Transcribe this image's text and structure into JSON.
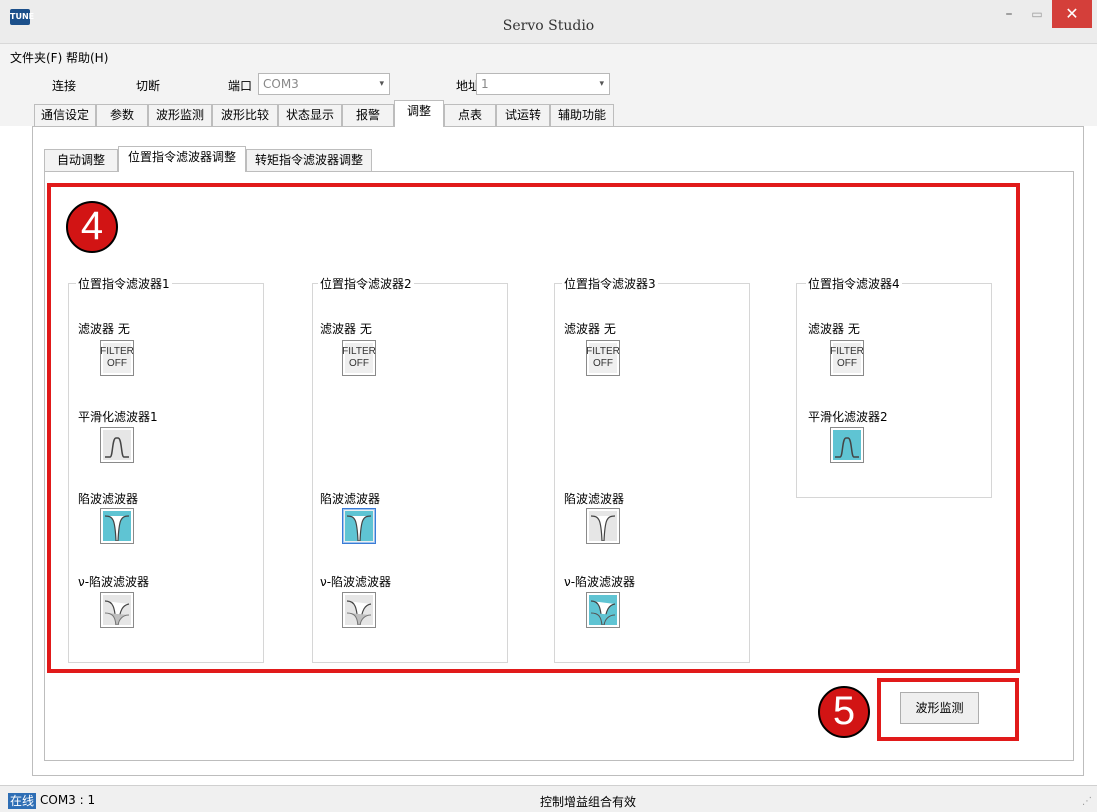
{
  "window": {
    "title": "Servo Studio",
    "icon_text": "TUNE"
  },
  "menu": {
    "items": [
      "文件夹(F)",
      "帮助(H)"
    ]
  },
  "toolbar": {
    "connect_label": "连接",
    "disconnect_label": "切断",
    "port_label": "端口",
    "port_value": "COM3",
    "address_label": "地址",
    "address_value": "1"
  },
  "tabs": [
    "通信设定",
    "参数",
    "波形监测",
    "波形比较",
    "状态显示",
    "报警",
    "调整",
    "点表",
    "试运转",
    "辅助功能"
  ],
  "subtabs": [
    "自动调整",
    "位置指令滤波器调整",
    "转矩指令滤波器调整"
  ],
  "annotations": {
    "badge4": "4",
    "badge5": "5",
    "box_color": "#e11a1a"
  },
  "filters": {
    "filter_label": "滤波器 无",
    "filter_off_line1": "FILTER",
    "filter_off_line2": "OFF",
    "notch_label": "陷波滤波器",
    "v_notch_label": "ν-陷波滤波器",
    "groups": [
      {
        "title": "位置指令滤波器1",
        "smoothing_label": "平滑化滤波器1"
      },
      {
        "title": "位置指令滤波器2"
      },
      {
        "title": "位置指令滤波器3"
      },
      {
        "title": "位置指令滤波器4",
        "smoothing_label": "平滑化滤波器2"
      }
    ]
  },
  "wave_monitor_button": "波形监测",
  "status": {
    "online": "在线",
    "port": "COM3 : 1",
    "message": "控制增益组合有效"
  },
  "colors": {
    "active_filter": "#5fc4d3",
    "inactive_filter": "#e6e6e6",
    "close_button": "#d43f3a",
    "online_badge": "#2e6eb5"
  }
}
